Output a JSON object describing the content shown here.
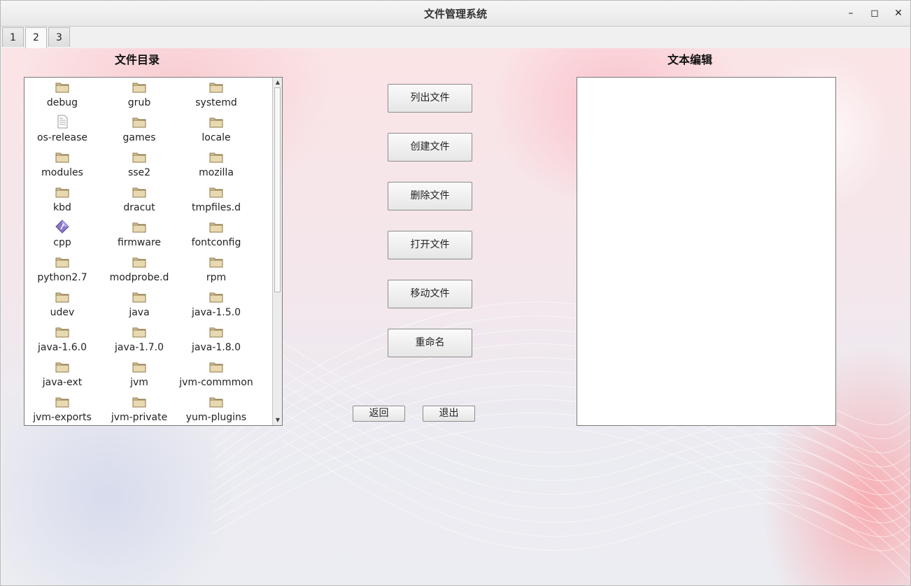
{
  "window": {
    "title": "文件管理系统",
    "minimize_glyph": "–",
    "maximize_glyph": "◻",
    "close_glyph": "✕"
  },
  "tabs": [
    {
      "label": "1",
      "active": false
    },
    {
      "label": "2",
      "active": true
    },
    {
      "label": "3",
      "active": false
    }
  ],
  "left_panel": {
    "heading": "文件目录"
  },
  "right_panel": {
    "heading": "文本编辑",
    "editor_text": ""
  },
  "files": [
    {
      "name": "debug",
      "icon": "folder-icon"
    },
    {
      "name": "grub",
      "icon": "folder-icon"
    },
    {
      "name": "systemd",
      "icon": "folder-icon"
    },
    {
      "name": "os-release",
      "icon": "text-file-icon"
    },
    {
      "name": "games",
      "icon": "folder-icon"
    },
    {
      "name": "locale",
      "icon": "folder-icon"
    },
    {
      "name": "modules",
      "icon": "folder-icon"
    },
    {
      "name": "sse2",
      "icon": "folder-icon"
    },
    {
      "name": "mozilla",
      "icon": "folder-icon"
    },
    {
      "name": "kbd",
      "icon": "folder-icon"
    },
    {
      "name": "dracut",
      "icon": "folder-icon"
    },
    {
      "name": "tmpfiles.d",
      "icon": "folder-icon"
    },
    {
      "name": "cpp",
      "icon": "executable-icon"
    },
    {
      "name": "firmware",
      "icon": "folder-icon"
    },
    {
      "name": "fontconfig",
      "icon": "folder-icon"
    },
    {
      "name": "python2.7",
      "icon": "folder-icon"
    },
    {
      "name": "modprobe.d",
      "icon": "folder-icon"
    },
    {
      "name": "rpm",
      "icon": "folder-icon"
    },
    {
      "name": "udev",
      "icon": "folder-icon"
    },
    {
      "name": "java",
      "icon": "folder-icon"
    },
    {
      "name": "java-1.5.0",
      "icon": "folder-icon"
    },
    {
      "name": "java-1.6.0",
      "icon": "folder-icon"
    },
    {
      "name": "java-1.7.0",
      "icon": "folder-icon"
    },
    {
      "name": "java-1.8.0",
      "icon": "folder-icon"
    },
    {
      "name": "java-ext",
      "icon": "folder-icon"
    },
    {
      "name": "jvm",
      "icon": "folder-icon"
    },
    {
      "name": "jvm-commmon",
      "icon": "folder-icon"
    },
    {
      "name": "jvm-exports",
      "icon": "folder-icon"
    },
    {
      "name": "jvm-private",
      "icon": "folder-icon"
    },
    {
      "name": "yum-plugins",
      "icon": "folder-icon"
    }
  ],
  "actions": {
    "list_files": "列出文件",
    "create_file": "创建文件",
    "delete_file": "删除文件",
    "open_file": "打开文件",
    "move_file": "移动文件",
    "rename": "重命名",
    "back": "返回",
    "exit": "退出"
  },
  "scrollbar": {
    "up_glyph": "▲",
    "down_glyph": "▼",
    "position": 0.0
  }
}
